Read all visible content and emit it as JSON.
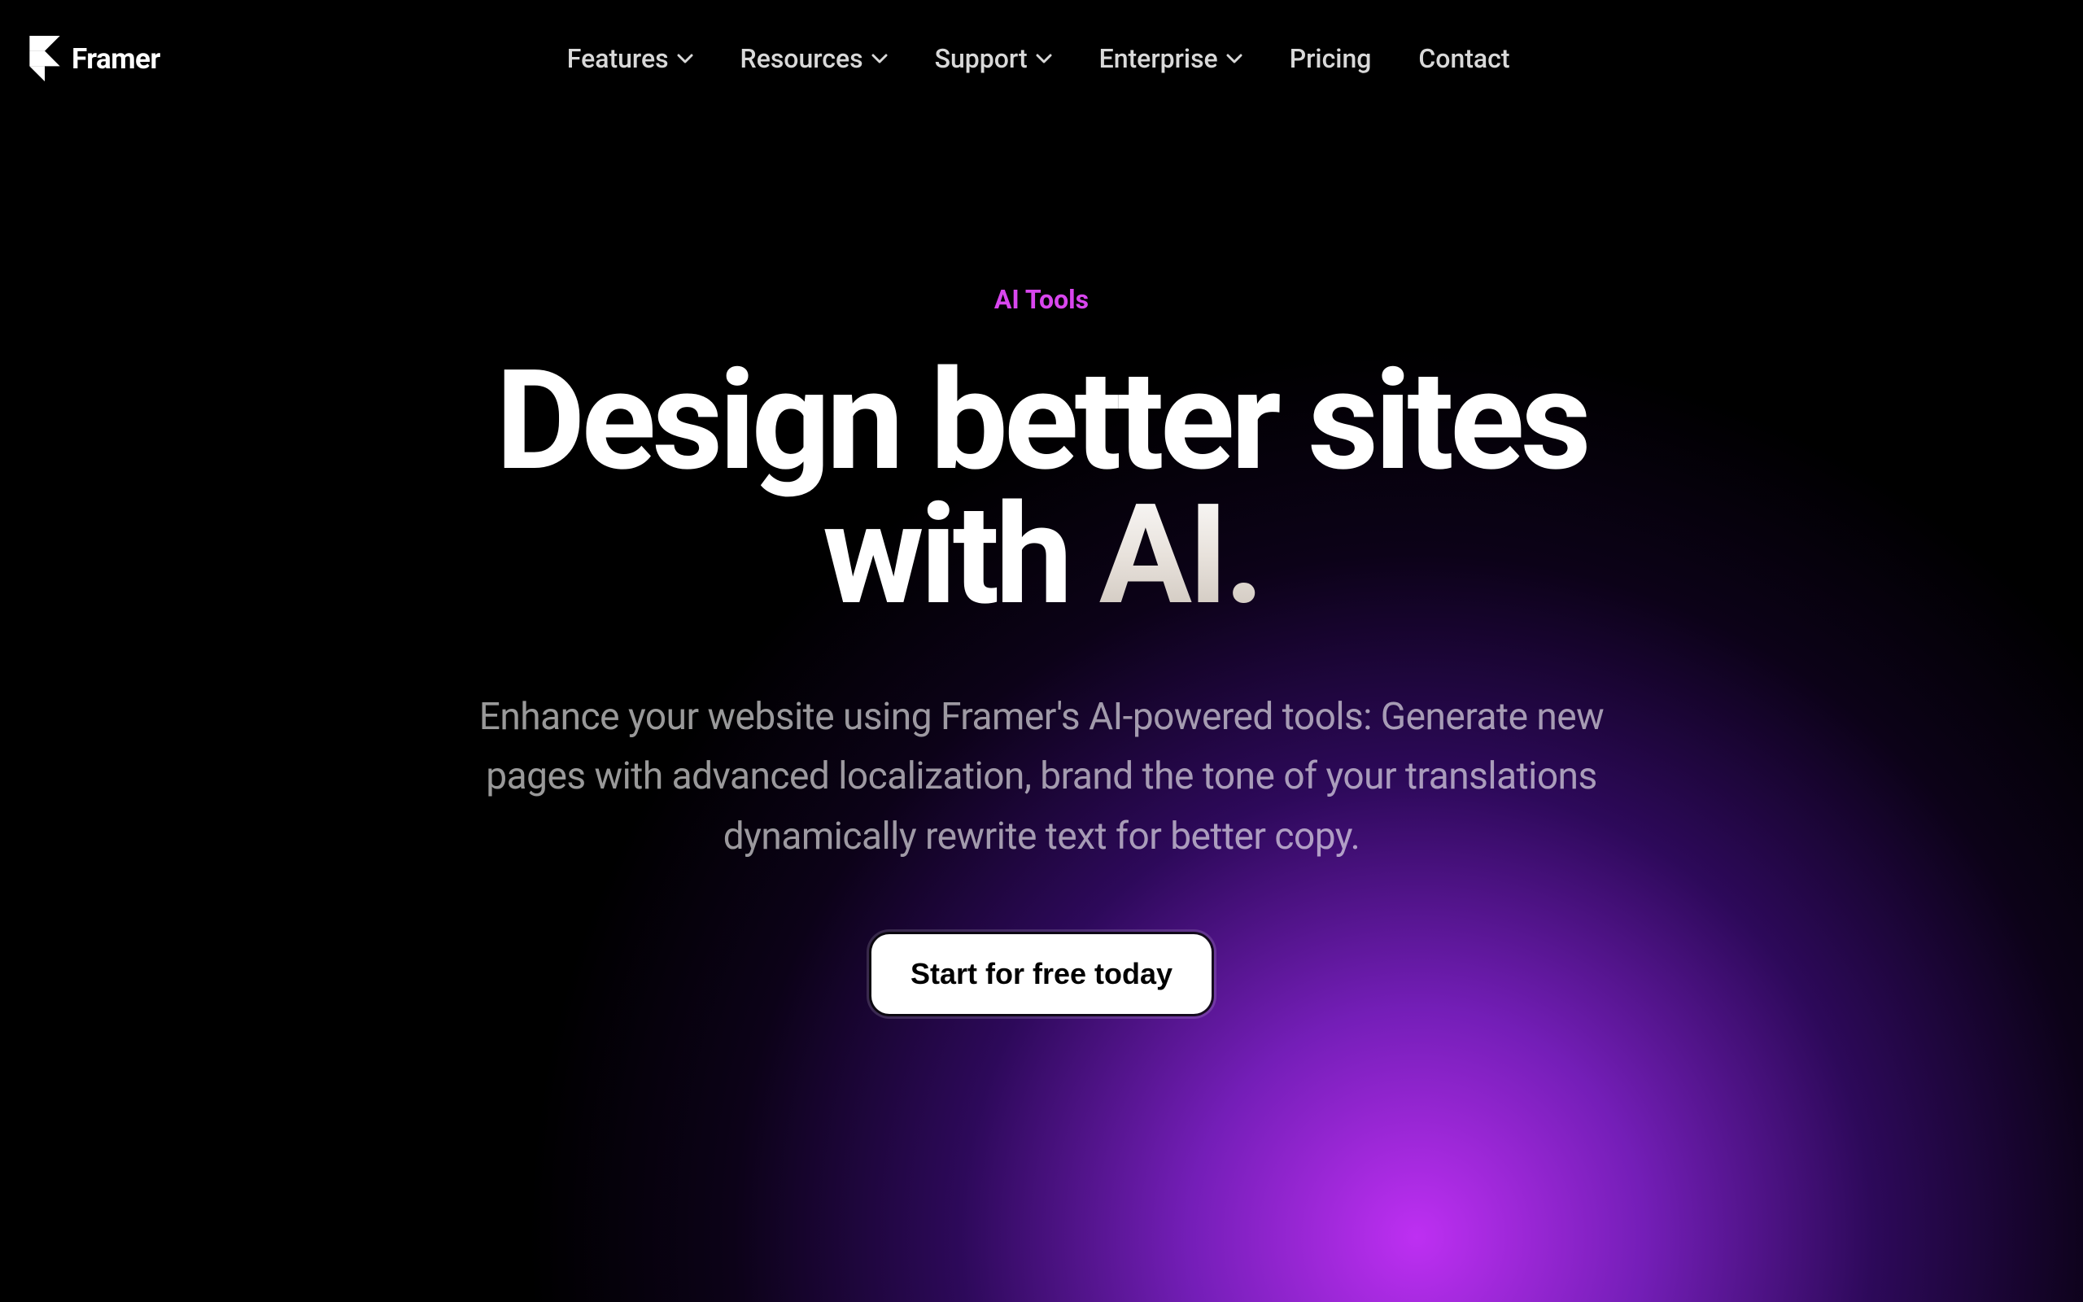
{
  "brand": {
    "name": "Framer"
  },
  "nav": {
    "items": [
      {
        "label": "Features",
        "hasDropdown": true
      },
      {
        "label": "Resources",
        "hasDropdown": true
      },
      {
        "label": "Support",
        "hasDropdown": true
      },
      {
        "label": "Enterprise",
        "hasDropdown": true
      },
      {
        "label": "Pricing",
        "hasDropdown": false
      },
      {
        "label": "Contact",
        "hasDropdown": false
      }
    ]
  },
  "hero": {
    "eyebrow": "AI Tools",
    "headline_part1": "Design better sites with ",
    "headline_part2": "AI.",
    "subheadline": "Enhance your website using Framer's AI-powered tools: Generate new pages with advanced localization, brand the tone of your translations dynamically rewrite text for better copy.",
    "cta": "Start for free today"
  }
}
